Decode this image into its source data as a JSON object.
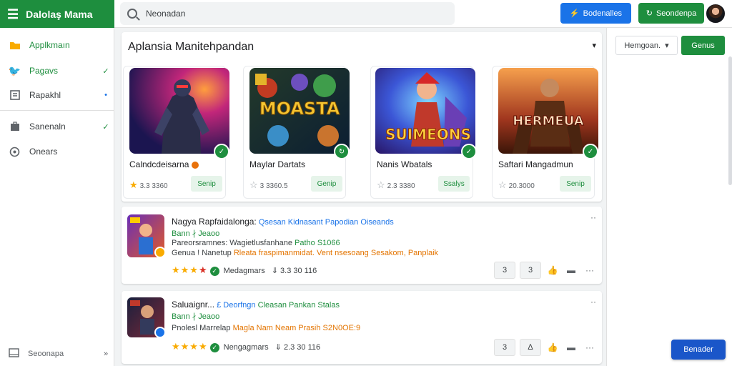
{
  "app": {
    "title": "Dalolaş Mama"
  },
  "search": {
    "value": "Neonadan"
  },
  "topbar": {
    "blue_button": "Bodenalles",
    "green_button": "Seondenpa"
  },
  "sidebar": {
    "items": [
      {
        "label": "Applkmaın",
        "icon": "folder-icon",
        "right": ""
      },
      {
        "label": "Pagavs",
        "icon": "bird-icon",
        "right": "✓"
      },
      {
        "label": "Rapakhl",
        "icon": "report-icon",
        "right": "•"
      },
      {
        "label": "Sanenaln",
        "icon": "briefcase-icon",
        "right": "✓"
      },
      {
        "label": "Onears",
        "icon": "settings-icon",
        "right": ""
      }
    ],
    "footer": {
      "label": "Seoonapa",
      "right": "»"
    }
  },
  "featured": {
    "title": "Aplansia Manitehpandan",
    "cards": [
      {
        "title": "Calndcdeisarna",
        "rating": "3.3 3360",
        "button": "Senip",
        "art_text": "",
        "star_color": "gold"
      },
      {
        "title": "Maylar Dartats",
        "rating": "3 3360.5",
        "button": "Genip",
        "art_text": "MOASTA",
        "star_color": "gray"
      },
      {
        "title": "Nanis Wbatals",
        "rating": "2.3 3380",
        "button": "Ssalys",
        "art_text": "SUIMEONS",
        "star_color": "gray"
      },
      {
        "title": "Saftari Mangadmun",
        "rating": "20.3000",
        "button": "Senip",
        "art_text": "HERMEUA",
        "star_color": "gray"
      }
    ]
  },
  "list": [
    {
      "title": "Nagya Rapfaidalonga:",
      "title_link": "Qsesan Kidnasant Papodian Oiseands",
      "meta": "Bann ∤ Jeaoo",
      "desc_prefix": "Pareorsramnes: Wagietlusfanhane",
      "desc_highlight": "Patho S1066",
      "desc2_prefix": "Genua ! Nanetup",
      "desc2_highlight": "Rleata fraspimanmidat. Vent nsesoang Sesakom, Panplaik",
      "rating_label": "Medagmars",
      "stats": "3.3 30 116",
      "actions": [
        "3",
        "3"
      ]
    },
    {
      "title": "Saluaignr...",
      "title_link": "£ Deorfngn",
      "title_green": "Cleasan Pankan Stalas",
      "meta": "Bann ∤ Jeaoo",
      "desc_prefix": "Pnolesl Marrelap",
      "desc_highlight": "Magla Nam Neam Prasih S2N0OE:9",
      "rating_label": "Nengagmars",
      "stats": "2.3 30 116",
      "actions": [
        "3",
        "∆"
      ]
    }
  ],
  "right_panel": {
    "select": "Hemgoan.",
    "button": "Genus",
    "cta": "Benader"
  }
}
